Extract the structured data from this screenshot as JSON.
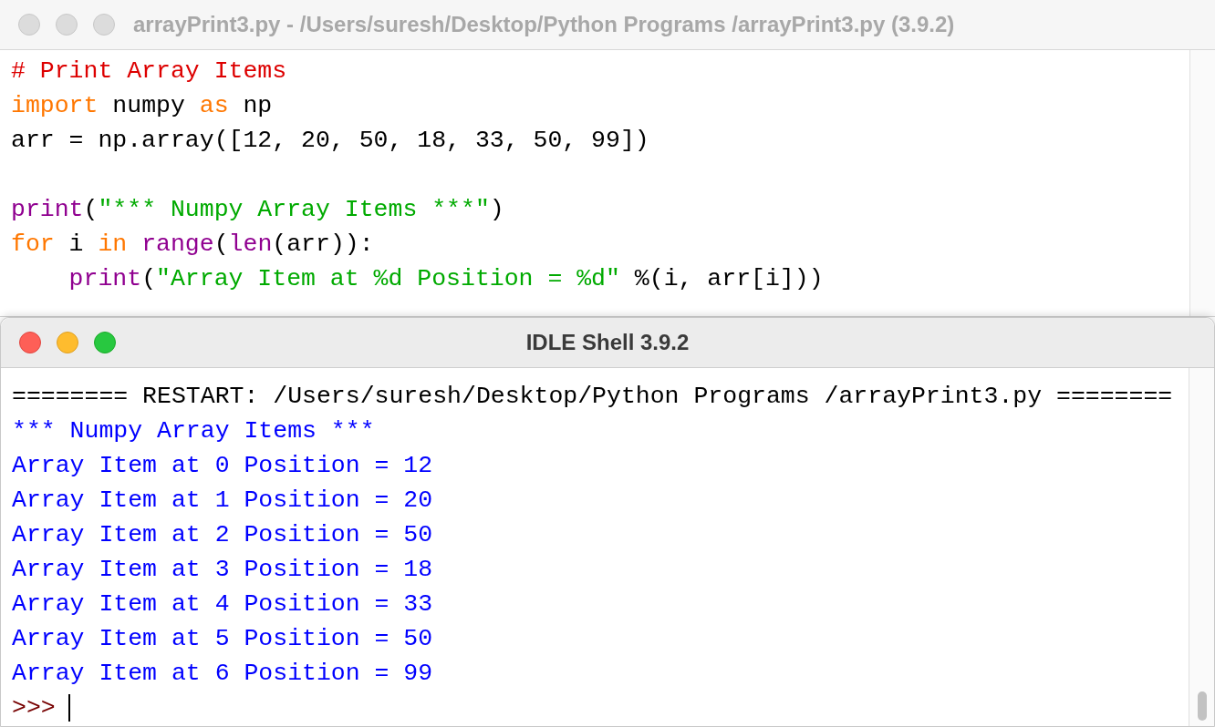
{
  "editor": {
    "title": "arrayPrint3.py - /Users/suresh/Desktop/Python Programs /arrayPrint3.py (3.9.2)",
    "active": false,
    "lines": [
      {
        "kind": "code",
        "segments": [
          {
            "kind": "comment",
            "text": "# Print Array Items"
          }
        ]
      },
      {
        "kind": "code",
        "segments": [
          {
            "kind": "keyword",
            "text": "import"
          },
          {
            "kind": "plain",
            "text": " numpy "
          },
          {
            "kind": "keyword",
            "text": "as"
          },
          {
            "kind": "plain",
            "text": " np"
          }
        ]
      },
      {
        "kind": "code",
        "segments": [
          {
            "kind": "plain",
            "text": "arr = np.array([12, 20, 50, 18, 33, 50, 99])"
          }
        ]
      },
      {
        "kind": "blank"
      },
      {
        "kind": "code",
        "segments": [
          {
            "kind": "builtin",
            "text": "print"
          },
          {
            "kind": "plain",
            "text": "("
          },
          {
            "kind": "string",
            "text": "\"*** Numpy Array Items ***\""
          },
          {
            "kind": "plain",
            "text": ")"
          }
        ]
      },
      {
        "kind": "code",
        "segments": [
          {
            "kind": "keyword",
            "text": "for"
          },
          {
            "kind": "plain",
            "text": " i "
          },
          {
            "kind": "keyword",
            "text": "in"
          },
          {
            "kind": "builtin",
            "text": " range"
          },
          {
            "kind": "plain",
            "text": "("
          },
          {
            "kind": "builtin",
            "text": "len"
          },
          {
            "kind": "plain",
            "text": "(arr)):"
          }
        ]
      },
      {
        "kind": "code",
        "segments": [
          {
            "kind": "builtin",
            "text": "    print"
          },
          {
            "kind": "plain",
            "text": "("
          },
          {
            "kind": "string",
            "text": "\"Array Item at %d Position = %d\""
          },
          {
            "kind": "plain",
            "text": " %(i, arr[i]))"
          }
        ]
      }
    ]
  },
  "shell": {
    "title": "IDLE Shell 3.9.2",
    "active": true,
    "lines": [
      {
        "kind": "restart",
        "text": "======== RESTART: /Users/suresh/Desktop/Python Programs /arrayPrint3.py ========"
      },
      {
        "kind": "output",
        "text": "*** Numpy Array Items ***"
      },
      {
        "kind": "output",
        "text": "Array Item at 0 Position = 12"
      },
      {
        "kind": "output",
        "text": "Array Item at 1 Position = 20"
      },
      {
        "kind": "output",
        "text": "Array Item at 2 Position = 50"
      },
      {
        "kind": "output",
        "text": "Array Item at 3 Position = 18"
      },
      {
        "kind": "output",
        "text": "Array Item at 4 Position = 33"
      },
      {
        "kind": "output",
        "text": "Array Item at 5 Position = 50"
      },
      {
        "kind": "output",
        "text": "Array Item at 6 Position = 99"
      },
      {
        "kind": "prompt",
        "text": ">>>"
      }
    ]
  }
}
